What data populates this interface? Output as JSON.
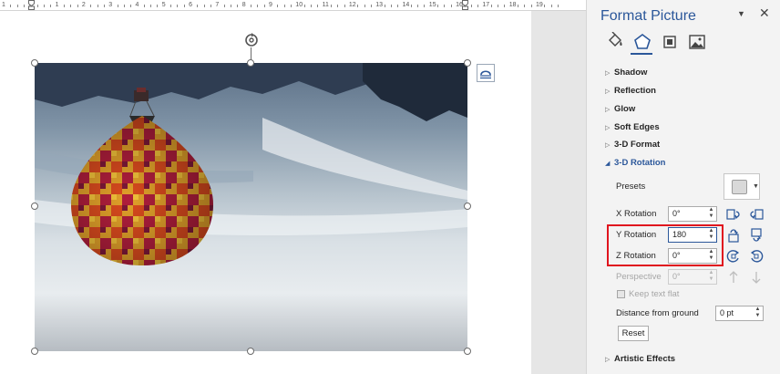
{
  "ruler": {
    "numbers": [
      "1",
      "2",
      "1",
      "2",
      "3",
      "4",
      "5",
      "6",
      "7",
      "8",
      "9",
      "10",
      "11",
      "12",
      "13",
      "14",
      "15",
      "16",
      "17",
      "18",
      "19"
    ]
  },
  "pane": {
    "title": "Format Picture",
    "tabs": [
      {
        "icon": "paint-bucket-icon",
        "label": "Fill & Line"
      },
      {
        "icon": "pentagon-icon",
        "label": "Effects"
      },
      {
        "icon": "size-icon",
        "label": "Layout & Properties"
      },
      {
        "icon": "picture-icon",
        "label": "Picture"
      }
    ],
    "sections": {
      "shadow": "Shadow",
      "reflection": "Reflection",
      "glow": "Glow",
      "soft_edges": "Soft Edges",
      "format_3d": "3-D Format",
      "rotation_3d": "3-D Rotation",
      "artistic_effects": "Artistic Effects"
    },
    "rotation": {
      "presets_label": "Presets",
      "x_label": "X Rotation",
      "x_value": "0°",
      "y_label": "Y Rotation",
      "y_value": "180",
      "z_label": "Z Rotation",
      "z_value": "0°",
      "perspective_label": "Perspective",
      "perspective_value": "0°",
      "keep_flat_label": "Keep text flat",
      "distance_label": "Distance from ground",
      "distance_value": "0 pt",
      "reset_label": "Reset"
    }
  },
  "colors": {
    "accent": "#2b579a",
    "highlight": "#e0141e"
  }
}
